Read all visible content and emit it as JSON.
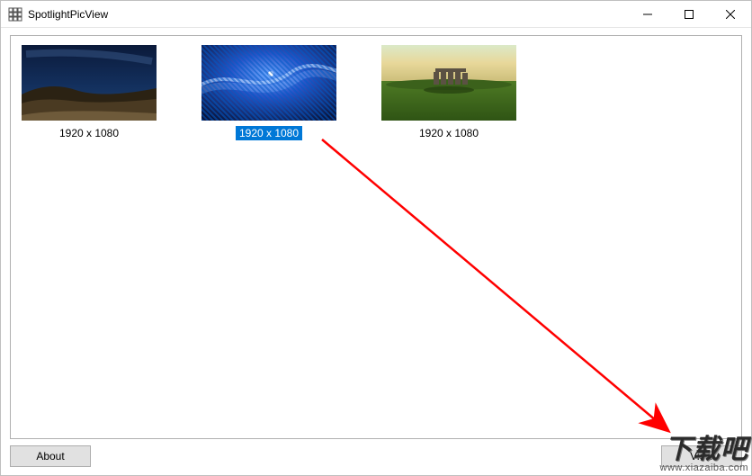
{
  "window": {
    "title": "SpotlightPicView"
  },
  "thumbnails": [
    {
      "caption": "1920 x 1080",
      "selected": false
    },
    {
      "caption": "1920 x 1080",
      "selected": true
    },
    {
      "caption": "1920 x 1080",
      "selected": false
    }
  ],
  "buttons": {
    "about": "About",
    "view": "View"
  },
  "watermark": {
    "main": "下载吧",
    "sub": "www.xiazaiba.com"
  }
}
